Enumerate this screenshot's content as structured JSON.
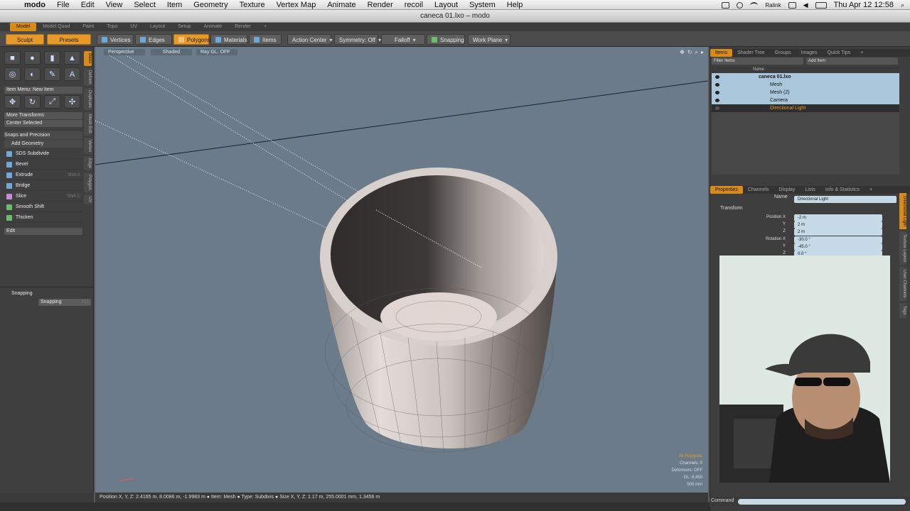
{
  "mac_menu": {
    "app": "modo",
    "items": [
      "File",
      "Edit",
      "View",
      "Select",
      "Item",
      "Geometry",
      "Texture",
      "Vertex Map",
      "Animate",
      "Render",
      "recoil",
      "Layout",
      "System",
      "Help"
    ],
    "user": "Ralink",
    "clock": "Thu Apr 12  12:58"
  },
  "window": {
    "title": "caneca 01.lxo – modo"
  },
  "layout_tabs": [
    "Model",
    "Model Quad",
    "Paint",
    "Topo",
    "UV",
    "Layout",
    "Setup",
    "Animate",
    "Render",
    "+"
  ],
  "toolbar": {
    "sculpt": "Sculpt",
    "presets": "Presets",
    "vertices": "Vertices",
    "edges": "Edges",
    "polygons": "Polygons",
    "materials": "Materials",
    "items": "Items",
    "action_center": "Action Center",
    "symmetry": "Symmetry: Off",
    "falloff": "Falloff",
    "snapping": "Snapping",
    "work_plane": "Work Plane"
  },
  "left_panel": {
    "item_menu": "Item Menu: New Item",
    "more_transforms": "More Transforms",
    "center_selected": "Center Selected",
    "snaps_precision": "Snaps and Precision",
    "add_geometry": "Add Geometry",
    "geometry_tools": [
      {
        "label": "SDS Subdivide",
        "shortcut": ""
      },
      {
        "label": "Bevel",
        "shortcut": ""
      },
      {
        "label": "Extrude",
        "shortcut": "Shift-X"
      },
      {
        "label": "Bridge",
        "shortcut": ""
      },
      {
        "label": "Slice",
        "shortcut": "Shift-C"
      },
      {
        "label": "Smooth Shift",
        "shortcut": ""
      },
      {
        "label": "Thicken",
        "shortcut": ""
      }
    ],
    "edit": "Edit",
    "snapping_head": "Snapping",
    "snapping_btn": "Snapping",
    "snapping_key": "F11",
    "vertical_tabs": [
      "Basic",
      "Deform",
      "Duplicate",
      "Mesh Edit",
      "Vertex",
      "Edge",
      "Polygon",
      "UV"
    ]
  },
  "viewport": {
    "view": "Perspective",
    "shading": "Shaded",
    "raygl": "Ray GL: OFF",
    "info": {
      "selection": "All Polygons",
      "channels": "Channels: 0",
      "deformers": "Deformers: OFF",
      "gl": "GL: 8,450",
      "scale": "500 mm"
    }
  },
  "status": {
    "position": "Position X, Y, Z:   2.4165 m, 8.0086 m, -1.9983 m",
    "item": "Item:  Mesh",
    "type": "Type:  Subdivis",
    "size": "Size X, Y, Z:   1.17 m, 255.0001 mm, 1.3456 m"
  },
  "items_panel": {
    "tabs": [
      "Items",
      "Shader Tree",
      "Groups",
      "Images",
      "Quick Tips",
      "+"
    ],
    "filter": "Filter Items",
    "add": "Add Item",
    "col_name": "Name",
    "rows": [
      {
        "name": "caneca 01.lxo",
        "indent": 0,
        "selected": false
      },
      {
        "name": "Mesh",
        "indent": 1,
        "selected": false
      },
      {
        "name": "Mesh (2)",
        "indent": 1,
        "selected": false
      },
      {
        "name": "Camera",
        "indent": 1,
        "selected": false
      },
      {
        "name": "Directional Light",
        "indent": 1,
        "selected": true
      }
    ]
  },
  "properties_panel": {
    "tabs": [
      "Properties",
      "Channels",
      "Display",
      "Lists",
      "Info & Statistics",
      "+"
    ],
    "name_label": "Name",
    "name_value": "Directional Light",
    "section": "Transform",
    "position_label": "Position X",
    "rotation_label": "Rotation X",
    "y_label": "Y",
    "z_label": "Z",
    "position": [
      "-2 m",
      "2 m",
      "2 m"
    ],
    "rotation": [
      "-30.0 °",
      "-45.0 °",
      "0.0 °"
    ],
    "vertical_tabs": [
      "Directional Light",
      "Texture Layers",
      "User Channels",
      "Tags"
    ]
  },
  "command": {
    "label": "Command"
  },
  "colors": {
    "accent": "#e69a2a",
    "viewport_bg": "#6b7b89",
    "selection": "#a9c6da"
  }
}
